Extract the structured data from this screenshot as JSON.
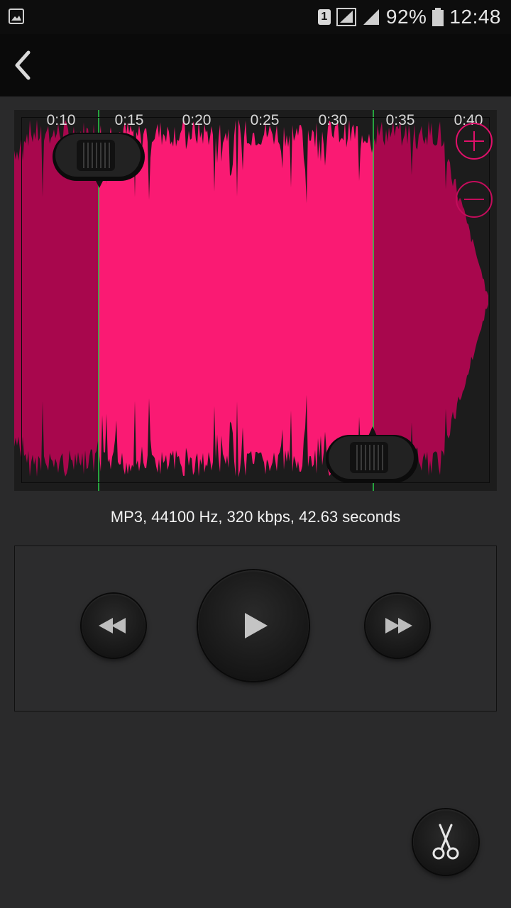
{
  "status_bar": {
    "sim_slot": "1",
    "battery_percent": "92%",
    "time": "12:48"
  },
  "waveform": {
    "time_labels": [
      "0:10",
      "0:15",
      "0:20",
      "0:25",
      "0:30",
      "0:35",
      "0:40"
    ],
    "colors": {
      "selected": "#fa1a73",
      "unselected": "#a8074d",
      "marker": "#29d14a"
    }
  },
  "file_info": "MP3, 44100 Hz, 320 kbps, 42.63 seconds",
  "icons": {
    "back": "chevron-left-icon",
    "zoom_in": "zoom-in-icon",
    "zoom_out": "zoom-out-icon",
    "rewind": "rewind-icon",
    "play": "play-icon",
    "fast_forward": "fast-forward-icon",
    "cut": "scissors-icon"
  }
}
